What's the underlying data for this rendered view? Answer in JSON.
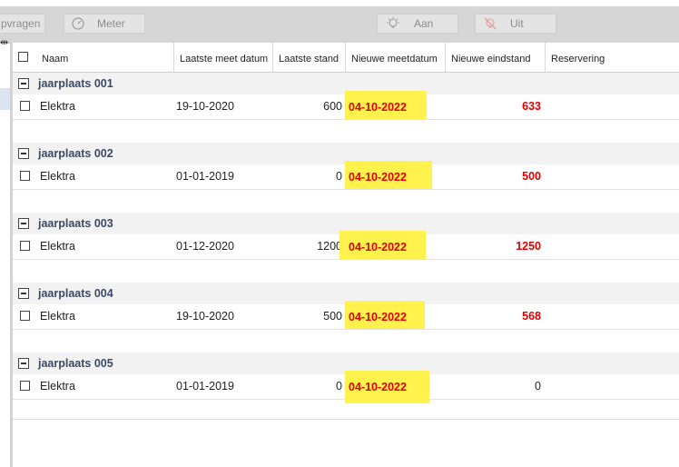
{
  "toolbar": {
    "opvragen_label": "pvragen",
    "meter_label": "Meter",
    "aan_label": "Aan",
    "uit_label": "Uit"
  },
  "resize_glyph": "⇹",
  "columns": {
    "naam": "Naam",
    "laatste_meet_datum": "Laatste meet datum",
    "laatste_stand": "Laatste stand",
    "nieuwe_meetdatum": "Nieuwe meetdatum",
    "nieuwe_eindstand": "Nieuwe eindstand",
    "reservering": "Reservering"
  },
  "groups": [
    {
      "title": "jaarplaats 001",
      "row": {
        "naam": "Elektra",
        "laatste_meet_datum": "19-10-2020",
        "laatste_stand": "600",
        "nieuwe_meetdatum": "04-10-2022",
        "nieuwe_eindstand": "633"
      }
    },
    {
      "title": "jaarplaats 002",
      "row": {
        "naam": "Elektra",
        "laatste_meet_datum": "01-01-2019",
        "laatste_stand": "0",
        "nieuwe_meetdatum": "04-10-2022",
        "nieuwe_eindstand": "500"
      }
    },
    {
      "title": "jaarplaats 003",
      "row": {
        "naam": "Elektra",
        "laatste_meet_datum": "01-12-2020",
        "laatste_stand": "1200",
        "nieuwe_meetdatum": "04-10-2022",
        "nieuwe_eindstand": "1250"
      }
    },
    {
      "title": "jaarplaats 004",
      "row": {
        "naam": "Elektra",
        "laatste_meet_datum": "19-10-2020",
        "laatste_stand": "500",
        "nieuwe_meetdatum": "04-10-2022",
        "nieuwe_eindstand": "568"
      }
    },
    {
      "title": "jaarplaats 005",
      "row": {
        "naam": "Elektra",
        "laatste_meet_datum": "01-01-2019",
        "laatste_stand": "0",
        "nieuwe_meetdatum": "04-10-2022",
        "nieuwe_eindstand": "0"
      }
    }
  ],
  "colors": {
    "highlight": "#fff24d",
    "value_red": "#e00000",
    "group_title": "#3b4a67"
  }
}
